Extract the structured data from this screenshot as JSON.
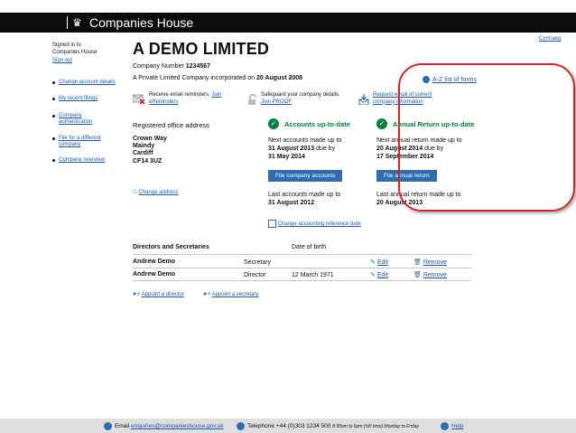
{
  "header": {
    "brand": "Companies House",
    "crest_icon": "royal-crest-icon"
  },
  "top_right_link": "Cymraeg",
  "sidebar": {
    "signed_in_line1": "Signed in to",
    "signed_in_line2": "Companies House",
    "sign_out": "Sign out",
    "items": [
      {
        "label": "Change account details"
      },
      {
        "label": "My recent filings"
      },
      {
        "label": "Company authentication"
      },
      {
        "label": "File for a different company"
      },
      {
        "label": "Company overview"
      }
    ]
  },
  "company": {
    "name": "A DEMO LIMITED",
    "number_label": "Company Number",
    "number": "1234567",
    "incorporated_text": "A Private Limited Company incorporated on",
    "incorporated_date": "20 August 2008"
  },
  "az_link": "A-Z list of forms",
  "services": {
    "email_text": "Receive email reminders.",
    "email_link": "Join eReminders",
    "safeguard_text": "Safeguard your company details.",
    "safeguard_link": "Join PROOF",
    "request_link": "Request email of current company information"
  },
  "office": {
    "heading": "Registered office address",
    "lines": [
      "Crown Way",
      "Maindy",
      "Cardiff",
      "CF14 3UZ"
    ],
    "change_link": "Change address"
  },
  "accounts": {
    "status": "Accounts up-to-date",
    "next_label": "Next accounts made up to",
    "next_date": "31 August 2013",
    "due_by": "due by",
    "due_date": "31 May 2014",
    "button": "File company accounts",
    "last_label": "Last accounts made up to",
    "last_date": "31 August 2012",
    "change_ref_link": "Change accounting reference date"
  },
  "annual_return": {
    "status": "Annual Return up-to-date",
    "next_label": "Next annual return made up to",
    "next_date": "20 August 2014",
    "due_by": "due by",
    "due_date": "17 September 2014",
    "button": "File annual return",
    "last_label": "Last annual return made up to",
    "last_date": "20 August 2013"
  },
  "directors": {
    "heading": "Directors and Secretaries",
    "dob_header": "Date of birth",
    "rows": [
      {
        "name": "Andrew Demo",
        "role": "Secretary",
        "dob": "",
        "edit": "Edit",
        "remove": "Remove"
      },
      {
        "name": "Andrew Demo",
        "role": "Director",
        "dob": "12 March 1971",
        "edit": "Edit",
        "remove": "Remove"
      }
    ],
    "appoint_director": "Appoint a director",
    "appoint_secretary": "Appoint a secretary"
  },
  "footer": {
    "email_label": "Email",
    "email": "enquiries@companieshouse.gov.uk",
    "phone_label": "Telephone",
    "phone": "+44 (0)303 1234 500",
    "hours": "8:30am to 6pm (UK time) Monday to Friday",
    "help": "Help"
  },
  "colors": {
    "accent": "#1d5ba8",
    "green": "#00823b",
    "button": "#2f6dae",
    "highlight": "#d8232a"
  }
}
